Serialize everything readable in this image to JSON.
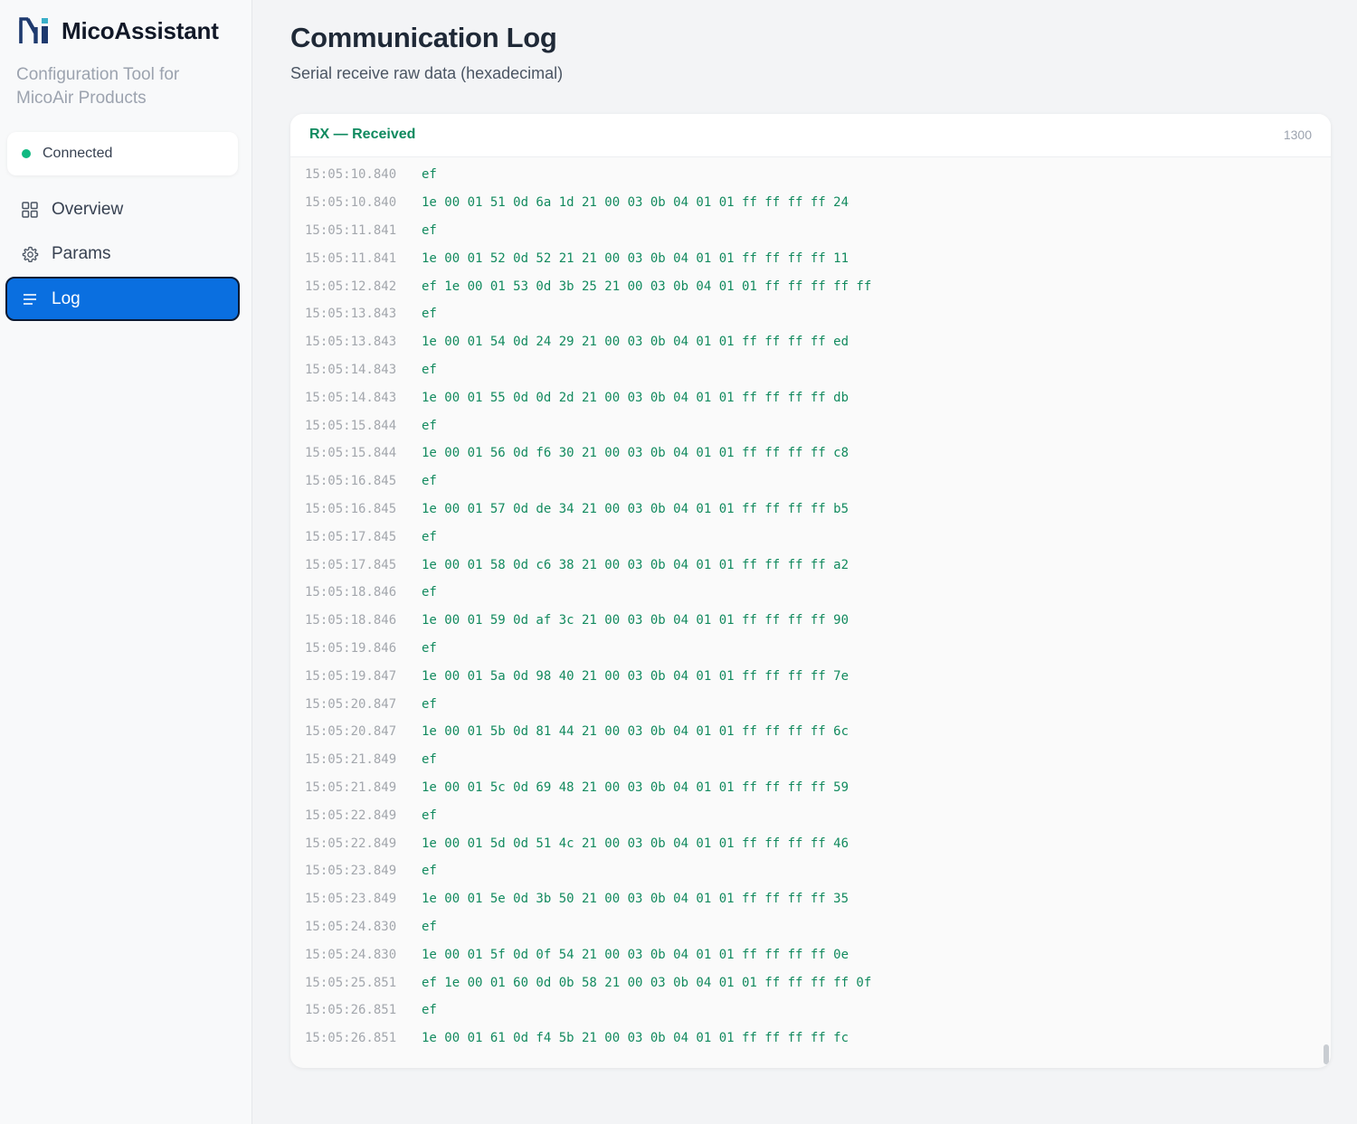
{
  "app": {
    "name": "MicoAssistant",
    "subtitle": "Configuration Tool for MicoAir Products"
  },
  "connection": {
    "status": "Connected",
    "color": "#10b981"
  },
  "nav": {
    "items": [
      {
        "label": "Overview",
        "icon": "grid-icon"
      },
      {
        "label": "Params",
        "icon": "gear-icon"
      },
      {
        "label": "Log",
        "icon": "list-icon",
        "active": true
      }
    ]
  },
  "page": {
    "title": "Communication Log",
    "subtitle": "Serial receive raw data (hexadecimal)"
  },
  "panel": {
    "title": "RX — Received",
    "count": "1300",
    "accent": "#0f8a5f"
  },
  "log": [
    {
      "time": "15:05:10.840",
      "data": "ef"
    },
    {
      "time": "15:05:10.840",
      "data": "1e 00 01 51 0d 6a 1d 21 00 03 0b 04 01 01 ff ff ff ff 24"
    },
    {
      "time": "15:05:11.841",
      "data": "ef"
    },
    {
      "time": "15:05:11.841",
      "data": "1e 00 01 52 0d 52 21 21 00 03 0b 04 01 01 ff ff ff ff 11"
    },
    {
      "time": "15:05:12.842",
      "data": "ef 1e 00 01 53 0d 3b 25 21 00 03 0b 04 01 01 ff ff ff ff ff"
    },
    {
      "time": "15:05:13.843",
      "data": "ef"
    },
    {
      "time": "15:05:13.843",
      "data": "1e 00 01 54 0d 24 29 21 00 03 0b 04 01 01 ff ff ff ff ed"
    },
    {
      "time": "15:05:14.843",
      "data": "ef"
    },
    {
      "time": "15:05:14.843",
      "data": "1e 00 01 55 0d 0d 2d 21 00 03 0b 04 01 01 ff ff ff ff db"
    },
    {
      "time": "15:05:15.844",
      "data": "ef"
    },
    {
      "time": "15:05:15.844",
      "data": "1e 00 01 56 0d f6 30 21 00 03 0b 04 01 01 ff ff ff ff c8"
    },
    {
      "time": "15:05:16.845",
      "data": "ef"
    },
    {
      "time": "15:05:16.845",
      "data": "1e 00 01 57 0d de 34 21 00 03 0b 04 01 01 ff ff ff ff b5"
    },
    {
      "time": "15:05:17.845",
      "data": "ef"
    },
    {
      "time": "15:05:17.845",
      "data": "1e 00 01 58 0d c6 38 21 00 03 0b 04 01 01 ff ff ff ff a2"
    },
    {
      "time": "15:05:18.846",
      "data": "ef"
    },
    {
      "time": "15:05:18.846",
      "data": "1e 00 01 59 0d af 3c 21 00 03 0b 04 01 01 ff ff ff ff 90"
    },
    {
      "time": "15:05:19.846",
      "data": "ef"
    },
    {
      "time": "15:05:19.847",
      "data": "1e 00 01 5a 0d 98 40 21 00 03 0b 04 01 01 ff ff ff ff 7e"
    },
    {
      "time": "15:05:20.847",
      "data": "ef"
    },
    {
      "time": "15:05:20.847",
      "data": "1e 00 01 5b 0d 81 44 21 00 03 0b 04 01 01 ff ff ff ff 6c"
    },
    {
      "time": "15:05:21.849",
      "data": "ef"
    },
    {
      "time": "15:05:21.849",
      "data": "1e 00 01 5c 0d 69 48 21 00 03 0b 04 01 01 ff ff ff ff 59"
    },
    {
      "time": "15:05:22.849",
      "data": "ef"
    },
    {
      "time": "15:05:22.849",
      "data": "1e 00 01 5d 0d 51 4c 21 00 03 0b 04 01 01 ff ff ff ff 46"
    },
    {
      "time": "15:05:23.849",
      "data": "ef"
    },
    {
      "time": "15:05:23.849",
      "data": "1e 00 01 5e 0d 3b 50 21 00 03 0b 04 01 01 ff ff ff ff 35"
    },
    {
      "time": "15:05:24.830",
      "data": "ef"
    },
    {
      "time": "15:05:24.830",
      "data": "1e 00 01 5f 0d 0f 54 21 00 03 0b 04 01 01 ff ff ff ff 0e"
    },
    {
      "time": "15:05:25.851",
      "data": "ef 1e 00 01 60 0d 0b 58 21 00 03 0b 04 01 01 ff ff ff ff 0f"
    },
    {
      "time": "15:05:26.851",
      "data": "ef"
    },
    {
      "time": "15:05:26.851",
      "data": "1e 00 01 61 0d f4 5b 21 00 03 0b 04 01 01 ff ff ff ff fc"
    }
  ]
}
